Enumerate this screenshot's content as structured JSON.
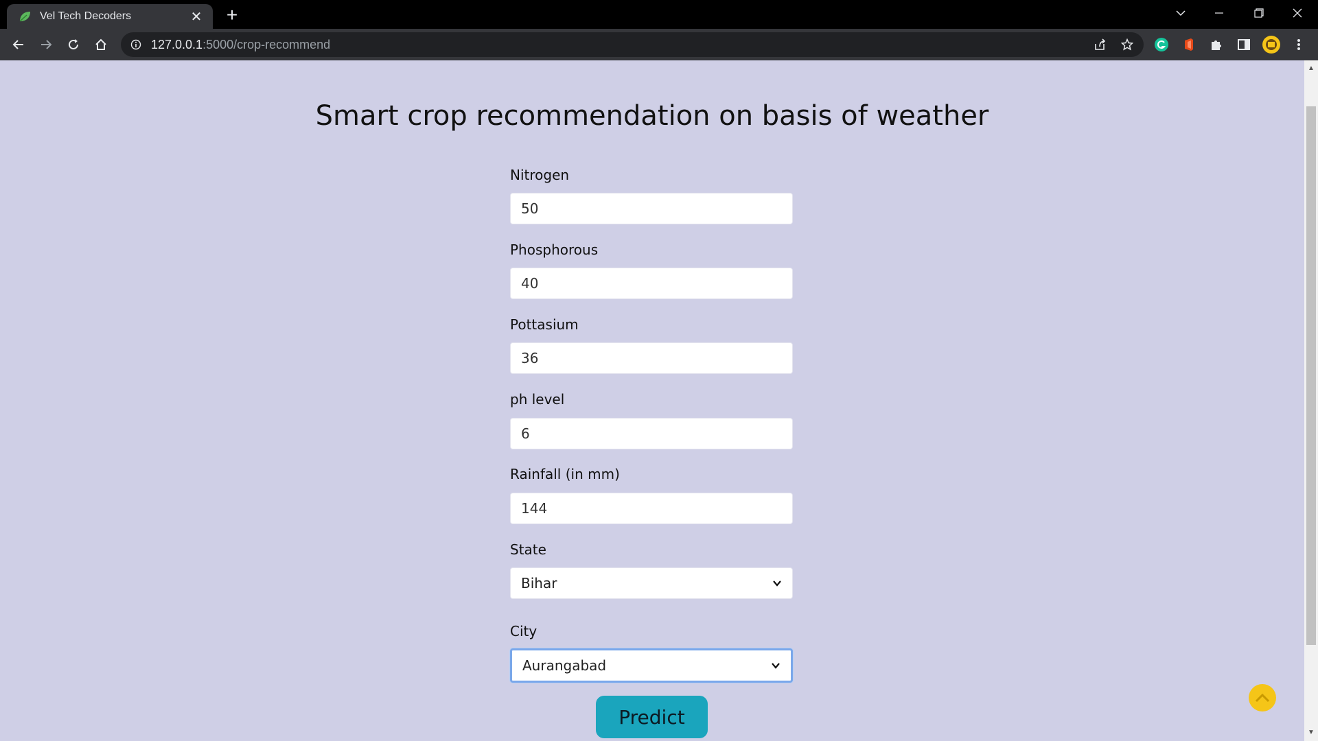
{
  "browser": {
    "tab_title": "Vel Tech Decoders",
    "url_host": "127.0.0.1",
    "url_rest": ":5000/crop-recommend"
  },
  "page": {
    "title": "Smart crop recommendation on basis of weather",
    "fields": [
      {
        "label": "Nitrogen",
        "value": "50"
      },
      {
        "label": "Phosphorous",
        "value": "40"
      },
      {
        "label": "Pottasium",
        "value": "36"
      },
      {
        "label": "ph level",
        "value": "6"
      },
      {
        "label": "Rainfall (in mm)",
        "value": "144"
      }
    ],
    "state": {
      "label": "State",
      "selected": "Bihar"
    },
    "city": {
      "label": "City",
      "selected": "Aurangabad"
    },
    "predict_label": "Predict"
  },
  "colors": {
    "page_background": "#cfcfe6",
    "button": "#1aa5bd",
    "back_to_top": "#f5c518"
  }
}
